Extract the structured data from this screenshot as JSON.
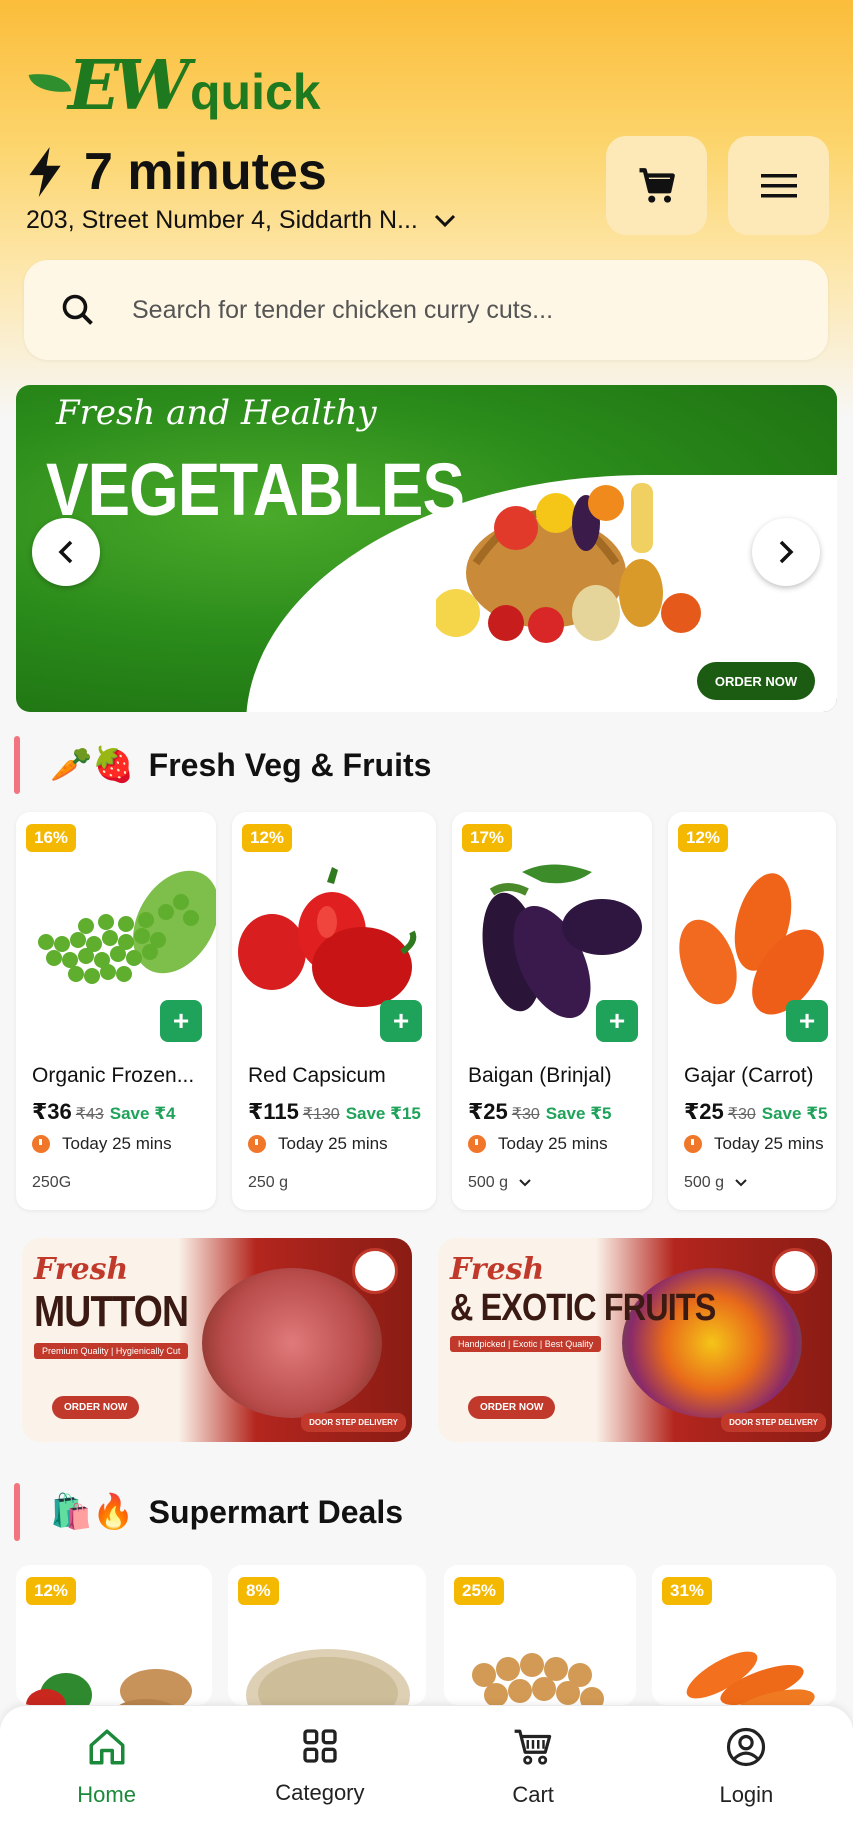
{
  "brand": {
    "logo_text": "EW",
    "logo_word": "quick"
  },
  "header": {
    "delivery_time": "7 minutes",
    "address": "203, Street Number 4, Siddarth N..."
  },
  "search": {
    "placeholder": "Search for tender chicken curry cuts..."
  },
  "hero_banner": {
    "tagline": "Fresh and Healthy",
    "title": "VEGETABLES",
    "cta": "ORDER NOW"
  },
  "sections": {
    "fresh": {
      "emoji": "🥕🍓",
      "title": "Fresh Veg & Fruits"
    },
    "supermart": {
      "emoji": "🛍️🔥",
      "title": "Supermart Deals"
    }
  },
  "products": [
    {
      "discount": "16%",
      "name": "Organic Frozen...",
      "price": "₹36",
      "mrp": "₹43",
      "save": "Save ₹4",
      "eta": "Today 25 mins",
      "qty": "250G",
      "has_dropdown": false
    },
    {
      "discount": "12%",
      "name": "Red Capsicum",
      "price": "₹115",
      "mrp": "₹130",
      "save": "Save ₹15",
      "eta": "Today 25 mins",
      "qty": "250 g",
      "has_dropdown": false
    },
    {
      "discount": "17%",
      "name": "Baigan (Brinjal)",
      "price": "₹25",
      "mrp": "₹30",
      "save": "Save ₹5",
      "eta": "Today 25 mins",
      "qty": "500 g",
      "has_dropdown": true
    },
    {
      "discount": "12%",
      "name": "Gajar (Carrot)",
      "price": "₹25",
      "mrp": "₹30",
      "save": "Save ₹5",
      "eta": "Today 25 mins",
      "qty": "500 g",
      "has_dropdown": true
    }
  ],
  "promos": [
    {
      "fresh": "Fresh",
      "title": "MUTTON",
      "sub": "Premium Quality | Hygienically Cut",
      "cta": "ORDER NOW",
      "delivery": "DOOR STEP DELIVERY"
    },
    {
      "fresh": "Fresh",
      "title": "& EXOTIC FRUITS",
      "sub": "Handpicked | Exotic | Best Quality",
      "cta": "ORDER NOW",
      "delivery": "DOOR STEP DELIVERY"
    }
  ],
  "deals": [
    {
      "discount": "12%"
    },
    {
      "discount": "8%"
    },
    {
      "discount": "25%"
    },
    {
      "discount": "31%"
    }
  ],
  "tabs": [
    {
      "label": "Home",
      "icon": "home-icon",
      "active": true
    },
    {
      "label": "Category",
      "icon": "grid-icon",
      "active": false
    },
    {
      "label": "Cart",
      "icon": "cart-icon",
      "active": false
    },
    {
      "label": "Login",
      "icon": "user-icon",
      "active": false
    }
  ],
  "colors": {
    "brand_green": "#1f7a1f",
    "accent_green": "#1fa25a",
    "badge_yellow": "#f5b800",
    "header_yellow": "#fbbd3a"
  }
}
